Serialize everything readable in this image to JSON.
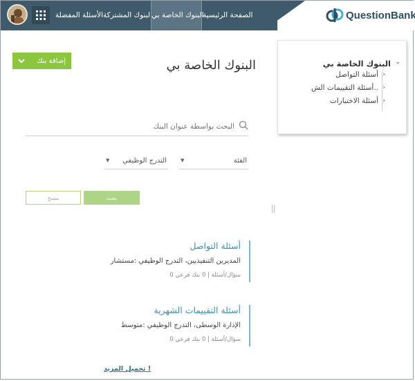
{
  "app": {
    "logo_text": "QuestionBank"
  },
  "nav": {
    "items": [
      {
        "label": "الصفحة الرئيسية"
      },
      {
        "label": "البنوك الخاصة بي",
        "active": true
      },
      {
        "label": "البنوك المشتركة"
      },
      {
        "label": "الأسئلة المفضلة"
      }
    ]
  },
  "sidebar": {
    "root_label": "البنوك الخاصة بي",
    "items": [
      {
        "label": "أسئلة التواصل"
      },
      {
        "label": "أسئلة التقييمات الش.."
      },
      {
        "label": "أسئلة الاختبارات"
      }
    ]
  },
  "main": {
    "title": "البنوك الخاصة بي",
    "add_bank_label": "إضافة بنك",
    "search_placeholder": "البحث بواسطة عنوان البنك",
    "filters": {
      "category_label": "الفئة",
      "grade_label": "التدرج الوظيفي"
    },
    "search_button": "بحث",
    "clear_button": "مسح",
    "banks": [
      {
        "title": "أسئلة التواصل",
        "meta": "المديرين التنفيذيين، التدرج الوظيفي :مستشار",
        "count": "0 سؤال/أسئلة | 0 بنك فرعي"
      },
      {
        "title": "أسئلة التقييمات الشهرية",
        "meta": "الإدارة الوسطى، التدرج الوظيفي :متوسط",
        "count": "0 سؤال/أسئلة | 0 بنك فرعي"
      }
    ],
    "load_more": "تحميل المزيد !"
  },
  "colors": {
    "nav_bg": "#3f5a6a",
    "accent_green": "#8cc63f",
    "bank_title": "#3d8fb0"
  }
}
